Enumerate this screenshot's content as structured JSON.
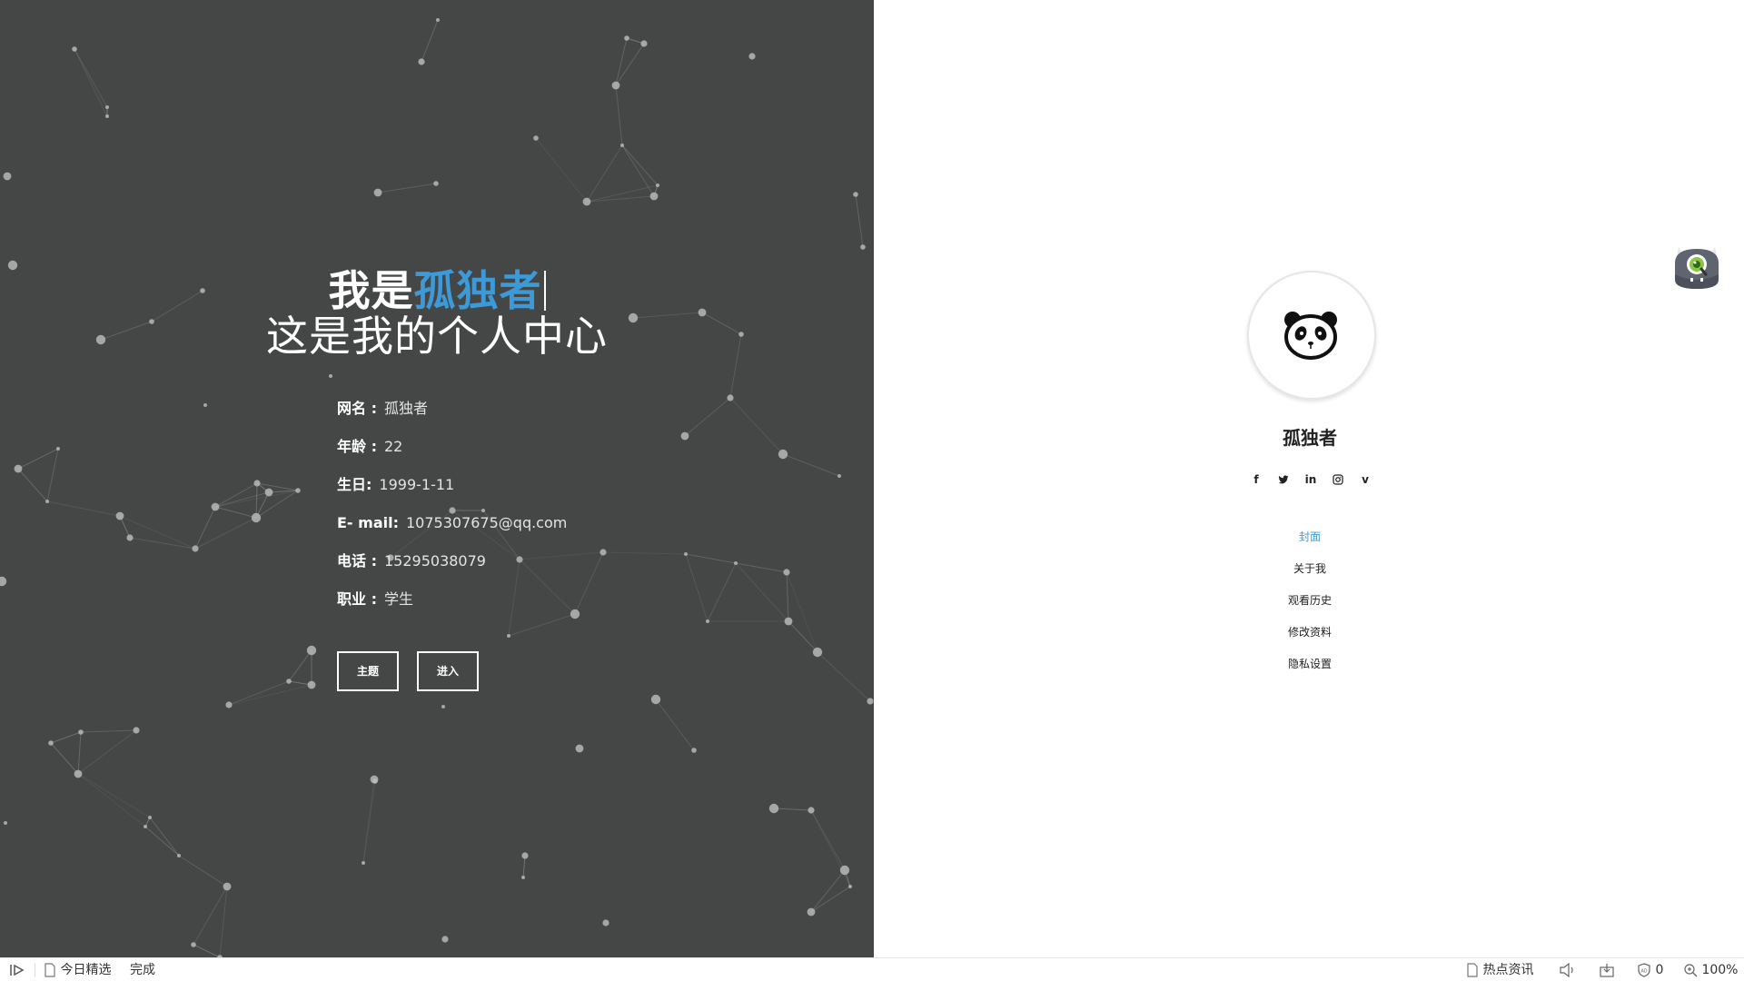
{
  "intro": {
    "prefix": "我是",
    "name": "孤独者",
    "subtitle": "这是我的个人中心"
  },
  "info": [
    {
      "label": "网名 :",
      "value": "孤独者"
    },
    {
      "label": "年龄 :",
      "value": "22"
    },
    {
      "label": "生日:",
      "value": "1999-1-11"
    },
    {
      "label": "E- mail:",
      "value": "1075307675@qq.com"
    },
    {
      "label": "电话 :",
      "value": "15295038079"
    },
    {
      "label": "职业 :",
      "value": "学生"
    }
  ],
  "buttons": {
    "theme": "主题",
    "enter": "进入"
  },
  "profile": {
    "name": "孤独者",
    "social": [
      {
        "icon": "facebook-icon",
        "glyph": "f"
      },
      {
        "icon": "twitter-icon",
        "glyph": "t"
      },
      {
        "icon": "linkedin-icon",
        "glyph": "in"
      },
      {
        "icon": "instagram-icon",
        "glyph": "◎"
      },
      {
        "icon": "vimeo-icon",
        "glyph": "v"
      }
    ]
  },
  "menu": [
    {
      "label": "封面",
      "active": true
    },
    {
      "label": "关于我",
      "active": false
    },
    {
      "label": "观看历史",
      "active": false
    },
    {
      "label": "修改资料",
      "active": false
    },
    {
      "label": "隐私设置",
      "active": false
    }
  ],
  "status_bar": {
    "today_pick": "今日精选",
    "done": "完成",
    "hot_news": "热点资讯",
    "shield_count": "0",
    "zoom": "100%"
  },
  "colors": {
    "left_bg": "#454646",
    "accent": "#3d9ad8",
    "white": "#ffffff"
  }
}
